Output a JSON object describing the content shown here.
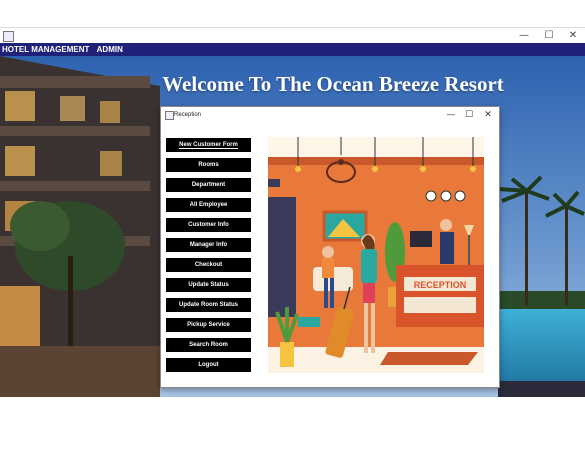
{
  "window": {
    "minimize_glyph": "—",
    "maximize_glyph": "☐",
    "close_glyph": "✕"
  },
  "menubar": {
    "items": [
      "HOTEL MANAGEMENT",
      "ADMIN"
    ]
  },
  "welcome_heading": "Welcome To The Ocean Breeze Resort",
  "reception": {
    "title": "Reception",
    "minimize_glyph": "—",
    "maximize_glyph": "☐",
    "close_glyph": "✕",
    "buttons": [
      "New Customer Form",
      "Rooms",
      "Department",
      "All Employee",
      "Customer Info",
      "Manager Info",
      "Checkout",
      "Update Status",
      "Update Room Status",
      "Pickup Service",
      "Search Room",
      "Logout"
    ],
    "illustration_sign": "RECEPTION"
  },
  "colors": {
    "menubar": "#1f2278",
    "button_bg": "#000000",
    "illustration_wall": "#e8793b",
    "reception_desk": "#d9532b"
  }
}
